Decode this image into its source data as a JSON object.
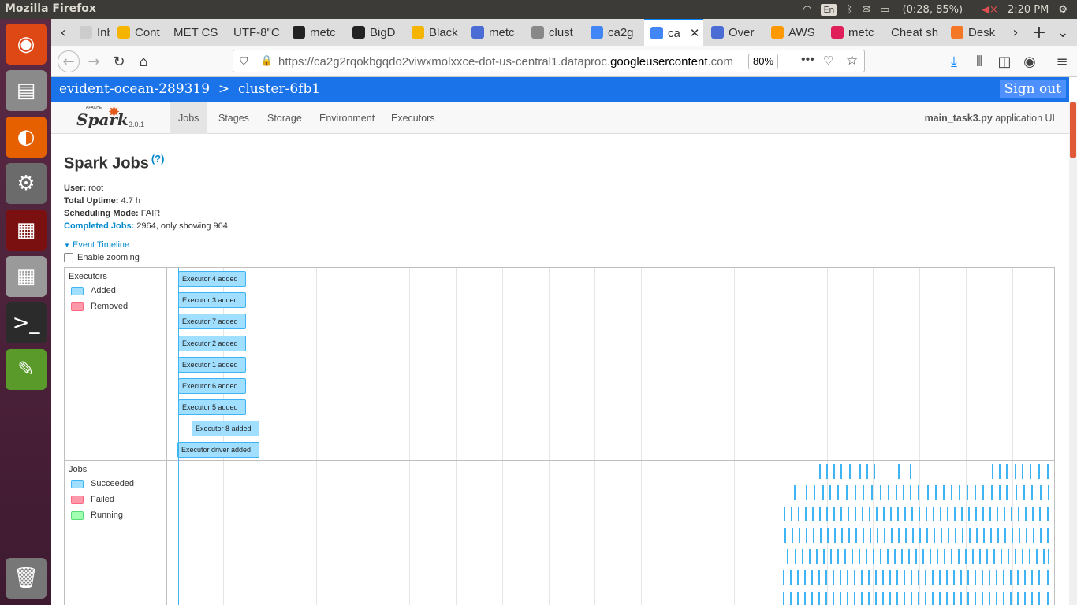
{
  "system": {
    "window_title": "Mozilla Firefox",
    "keyboard": "En",
    "battery": "(0:28, 85%)",
    "clock": "2:20 PM"
  },
  "launcher": [
    {
      "name": "ubuntu-dash-icon",
      "color": "#dd4814",
      "glyph": "◉"
    },
    {
      "name": "file-manager-icon",
      "color": "#8a8a8a",
      "glyph": "▤"
    },
    {
      "name": "firefox-icon",
      "color": "#e66000",
      "glyph": "◐"
    },
    {
      "name": "system-settings-icon",
      "color": "#6b6b6b",
      "glyph": "⚙"
    },
    {
      "name": "system-monitor-icon",
      "color": "#7a1010",
      "glyph": "▦"
    },
    {
      "name": "calculator-icon",
      "color": "#9a9a9a",
      "glyph": "▦"
    },
    {
      "name": "terminal-icon",
      "color": "#2b2b2b",
      "glyph": ">_"
    },
    {
      "name": "text-editor-icon",
      "color": "#5a9a2a",
      "glyph": "✎"
    },
    {
      "name": "trash-icon",
      "color": "#777777",
      "glyph": "🗑"
    }
  ],
  "tabs": [
    {
      "label": "Inbox",
      "icon_color": "#cccccc"
    },
    {
      "label": "Cont",
      "icon_color": "#f4b400"
    },
    {
      "label": "MET CS",
      "icon_color": ""
    },
    {
      "label": "UTF-8\"C",
      "icon_color": ""
    },
    {
      "label": "metc",
      "icon_color": "#222222"
    },
    {
      "label": "BigD",
      "icon_color": "#222222"
    },
    {
      "label": "Black",
      "icon_color": "#f4b400"
    },
    {
      "label": "metc",
      "icon_color": "#4a6cd4"
    },
    {
      "label": "clust",
      "icon_color": "#888888"
    },
    {
      "label": "ca2g",
      "icon_color": "#4285f4"
    },
    {
      "label": "ca",
      "icon_color": "#4285f4"
    },
    {
      "label": "Over",
      "icon_color": "#4a6cd4"
    },
    {
      "label": "AWS",
      "icon_color": "#ff9900"
    },
    {
      "label": "metc",
      "icon_color": "#e01e5a"
    },
    {
      "label": "Cheat sh",
      "icon_color": ""
    },
    {
      "label": "Desk",
      "icon_color": "#f37726"
    }
  ],
  "url": {
    "prefix": "https://ca2g2rqokbgqdo2viwxmolxxce-dot-us-central1.dataproc.",
    "domain": "googleusercontent",
    "suffix": ".com",
    "zoom": "80%"
  },
  "dataproc": {
    "breadcrumb": "evident-ocean-289319  >  cluster-6fb1",
    "signout": "Sign out"
  },
  "spark": {
    "logo_text": "Spark",
    "logo_apache": "APACHE",
    "version": "3.0.1",
    "nav": [
      "Jobs",
      "Stages",
      "Storage",
      "Environment",
      "Executors"
    ],
    "app_name": "main_task3.py",
    "app_suffix": " application UI"
  },
  "page": {
    "title": "Spark Jobs",
    "help": "(?)",
    "user_label": "User:",
    "user": " root",
    "uptime_label": "Total Uptime:",
    "uptime": " 4.7 h",
    "sched_label": "Scheduling Mode:",
    "sched": " FAIR",
    "completed_label": "Completed Jobs:",
    "completed": " 2964, only showing 964",
    "timeline_toggle": "Event Timeline",
    "enable_zooming": "Enable zooming"
  },
  "timeline": {
    "executors_group": "Executors",
    "executors_legend": [
      {
        "label": "Added",
        "color": "#a0dfff"
      },
      {
        "label": "Removed",
        "color": "#ff99aa"
      }
    ],
    "jobs_group": "Jobs",
    "jobs_legend": [
      {
        "label": "Succeeded",
        "color": "#a0dfff"
      },
      {
        "label": "Failed",
        "color": "#ff99aa"
      },
      {
        "label": "Running",
        "color": "#a0ffb0"
      }
    ],
    "executor_events": [
      "Executor 4 added",
      "Executor 3 added",
      "Executor 7 added",
      "Executor 2 added",
      "Executor 1 added",
      "Executor 6 added",
      "Executor 5 added",
      "Executor 8 added",
      "Executor driver added"
    ]
  }
}
